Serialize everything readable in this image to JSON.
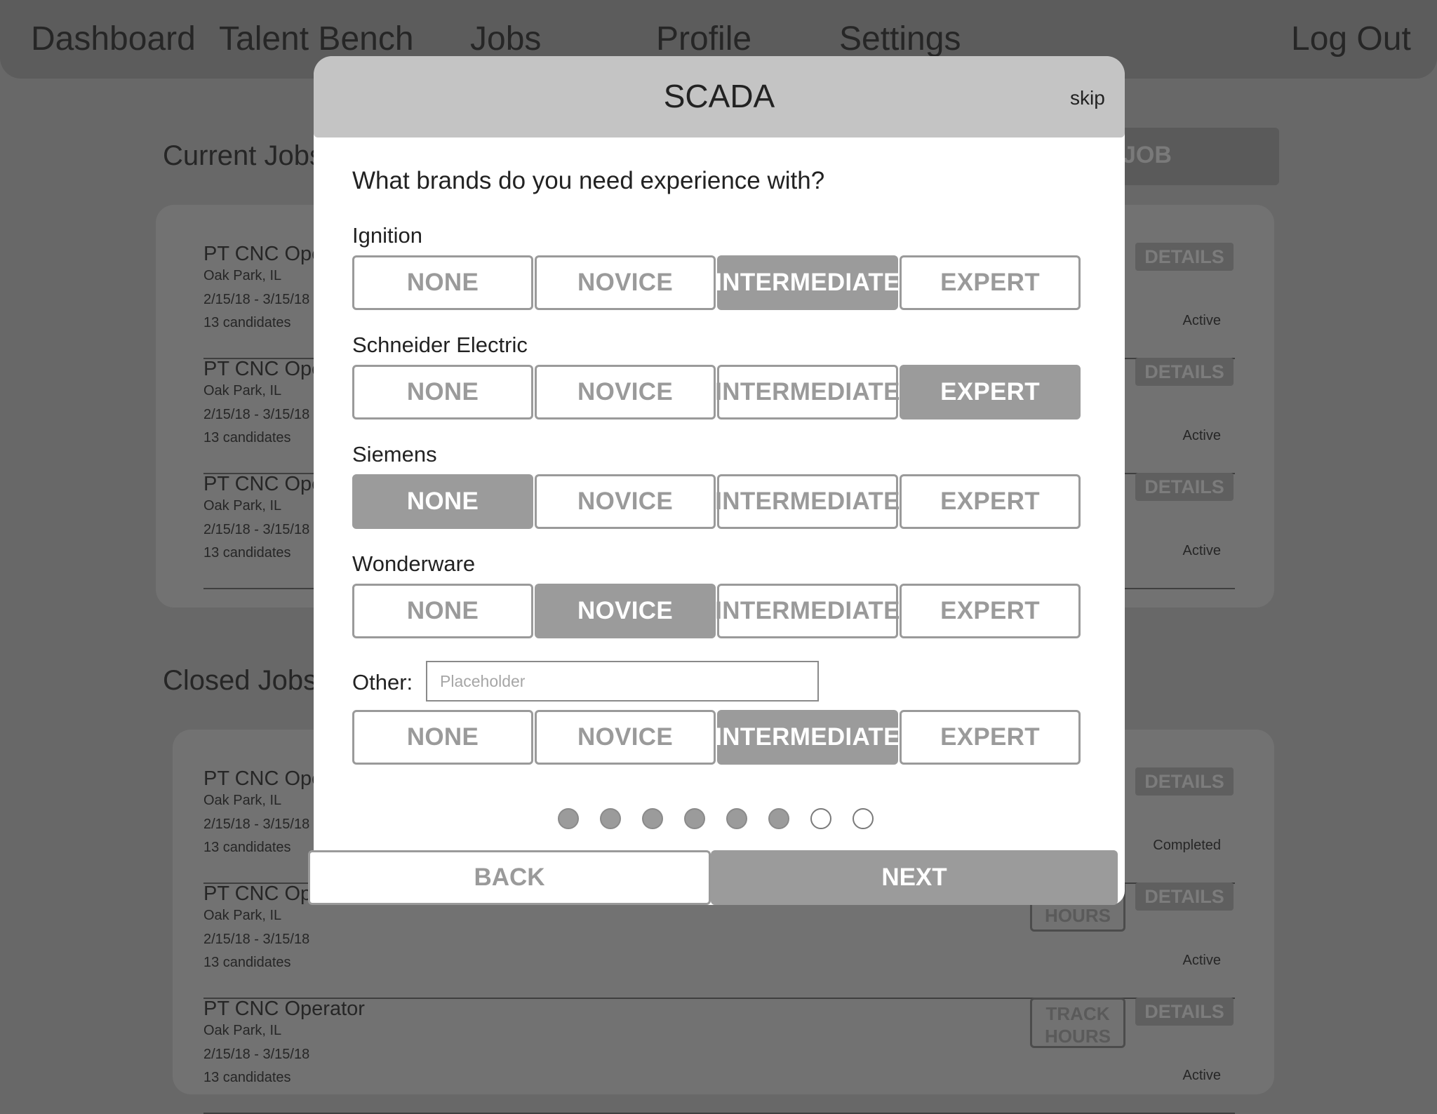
{
  "nav": {
    "dashboard": "Dashboard",
    "talent_bench": "Talent Bench",
    "jobs": "Jobs",
    "profile": "Profile",
    "settings": "Settings",
    "logout": "Log Out"
  },
  "current_jobs": {
    "title": "Current Jobs",
    "post_job_label": "JOB",
    "items": [
      {
        "title": "PT CNC Operator",
        "location": "Oak Park, IL",
        "dates": "2/15/18 - 3/15/18",
        "candidates": "13 candidates",
        "status": "Active",
        "details": "DETAILS"
      },
      {
        "title": "PT CNC Operator",
        "location": "Oak Park, IL",
        "dates": "2/15/18 - 3/15/18",
        "candidates": "13 candidates",
        "status": "Active",
        "details": "DETAILS"
      },
      {
        "title": "PT CNC Operator",
        "location": "Oak Park, IL",
        "dates": "2/15/18 - 3/15/18",
        "candidates": "13 candidates",
        "status": "Active",
        "details": "DETAILS"
      }
    ]
  },
  "closed_jobs": {
    "title": "Closed Jobs",
    "items": [
      {
        "title": "PT CNC Operator",
        "location": "Oak Park, IL",
        "dates": "2/15/18 - 3/15/18",
        "candidates": "13 candidates",
        "status": "Completed",
        "details": "DETAILS"
      },
      {
        "title": "PT CNC Operator",
        "location": "Oak Park, IL",
        "dates": "2/15/18 - 3/15/18",
        "candidates": "13 candidates",
        "status": "Active",
        "details": "DETAILS",
        "track": "HOURS"
      },
      {
        "title": "PT CNC Operator",
        "location": "Oak Park, IL",
        "dates": "2/15/18 - 3/15/18",
        "candidates": "13 candidates",
        "status": "Active",
        "details": "DETAILS",
        "track": "TRACK HOURS"
      }
    ]
  },
  "modal": {
    "title": "SCADA",
    "skip": "skip",
    "question": "What brands do you need experience with?",
    "levels": [
      "NONE",
      "NOVICE",
      "INTERMEDIATE",
      "EXPERT"
    ],
    "brands": [
      {
        "name": "Ignition",
        "selected": "INTERMEDIATE"
      },
      {
        "name": "Schneider Electric",
        "selected": "EXPERT"
      },
      {
        "name": "Siemens",
        "selected": "NONE"
      },
      {
        "name": "Wonderware",
        "selected": "NOVICE"
      }
    ],
    "other": {
      "label": "Other:",
      "placeholder": "Placeholder",
      "value": "",
      "selected": "INTERMEDIATE"
    },
    "progress": {
      "total_steps": 8,
      "completed_steps": 6
    },
    "back": "BACK",
    "next": "NEXT"
  }
}
